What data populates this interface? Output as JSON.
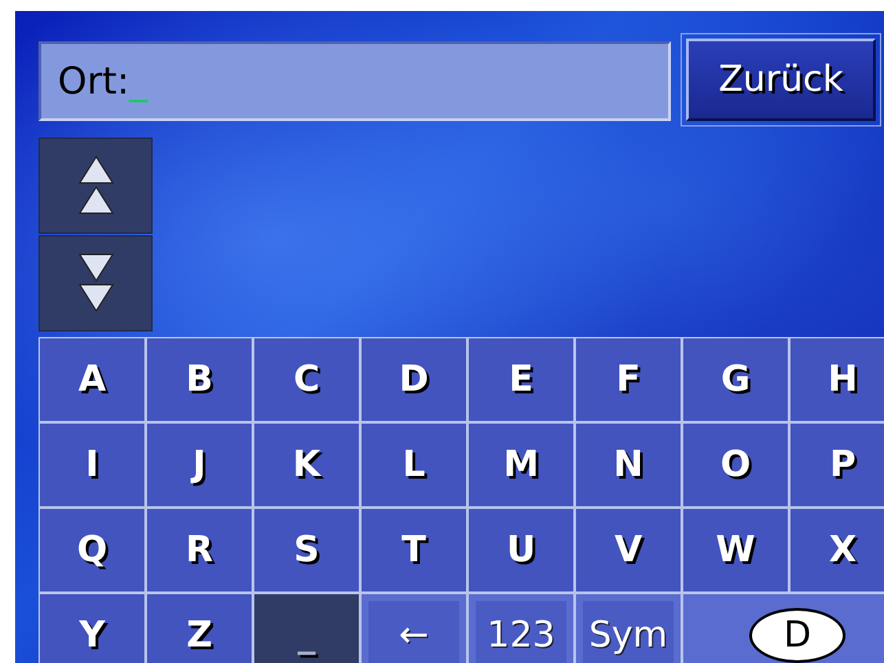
{
  "input": {
    "label": "Ort:",
    "cursor": "_"
  },
  "back_button": {
    "label": "Zurück"
  },
  "scroll_buttons": [
    {
      "kind": "up"
    },
    {
      "kind": "down"
    }
  ],
  "keys": [
    {
      "label": "A",
      "kind": "letter"
    },
    {
      "label": "B",
      "kind": "letter"
    },
    {
      "label": "C",
      "kind": "letter"
    },
    {
      "label": "D",
      "kind": "letter"
    },
    {
      "label": "E",
      "kind": "letter"
    },
    {
      "label": "F",
      "kind": "letter"
    },
    {
      "label": "G",
      "kind": "letter"
    },
    {
      "label": "H",
      "kind": "letter"
    },
    {
      "label": "I",
      "kind": "letter"
    },
    {
      "label": "J",
      "kind": "letter"
    },
    {
      "label": "K",
      "kind": "letter"
    },
    {
      "label": "L",
      "kind": "letter"
    },
    {
      "label": "M",
      "kind": "letter"
    },
    {
      "label": "N",
      "kind": "letter"
    },
    {
      "label": "O",
      "kind": "letter"
    },
    {
      "label": "P",
      "kind": "letter"
    },
    {
      "label": "Q",
      "kind": "letter"
    },
    {
      "label": "R",
      "kind": "letter"
    },
    {
      "label": "S",
      "kind": "letter"
    },
    {
      "label": "T",
      "kind": "letter"
    },
    {
      "label": "U",
      "kind": "letter"
    },
    {
      "label": "V",
      "kind": "letter"
    },
    {
      "label": "W",
      "kind": "letter"
    },
    {
      "label": "X",
      "kind": "letter"
    },
    {
      "label": "Y",
      "kind": "letter"
    },
    {
      "label": "Z",
      "kind": "letter"
    },
    {
      "label": "_",
      "kind": "space"
    },
    {
      "label": "←",
      "kind": "function"
    },
    {
      "label": "123",
      "kind": "function"
    },
    {
      "label": "Sym",
      "kind": "function"
    },
    {
      "label": "D",
      "kind": "country"
    }
  ]
}
